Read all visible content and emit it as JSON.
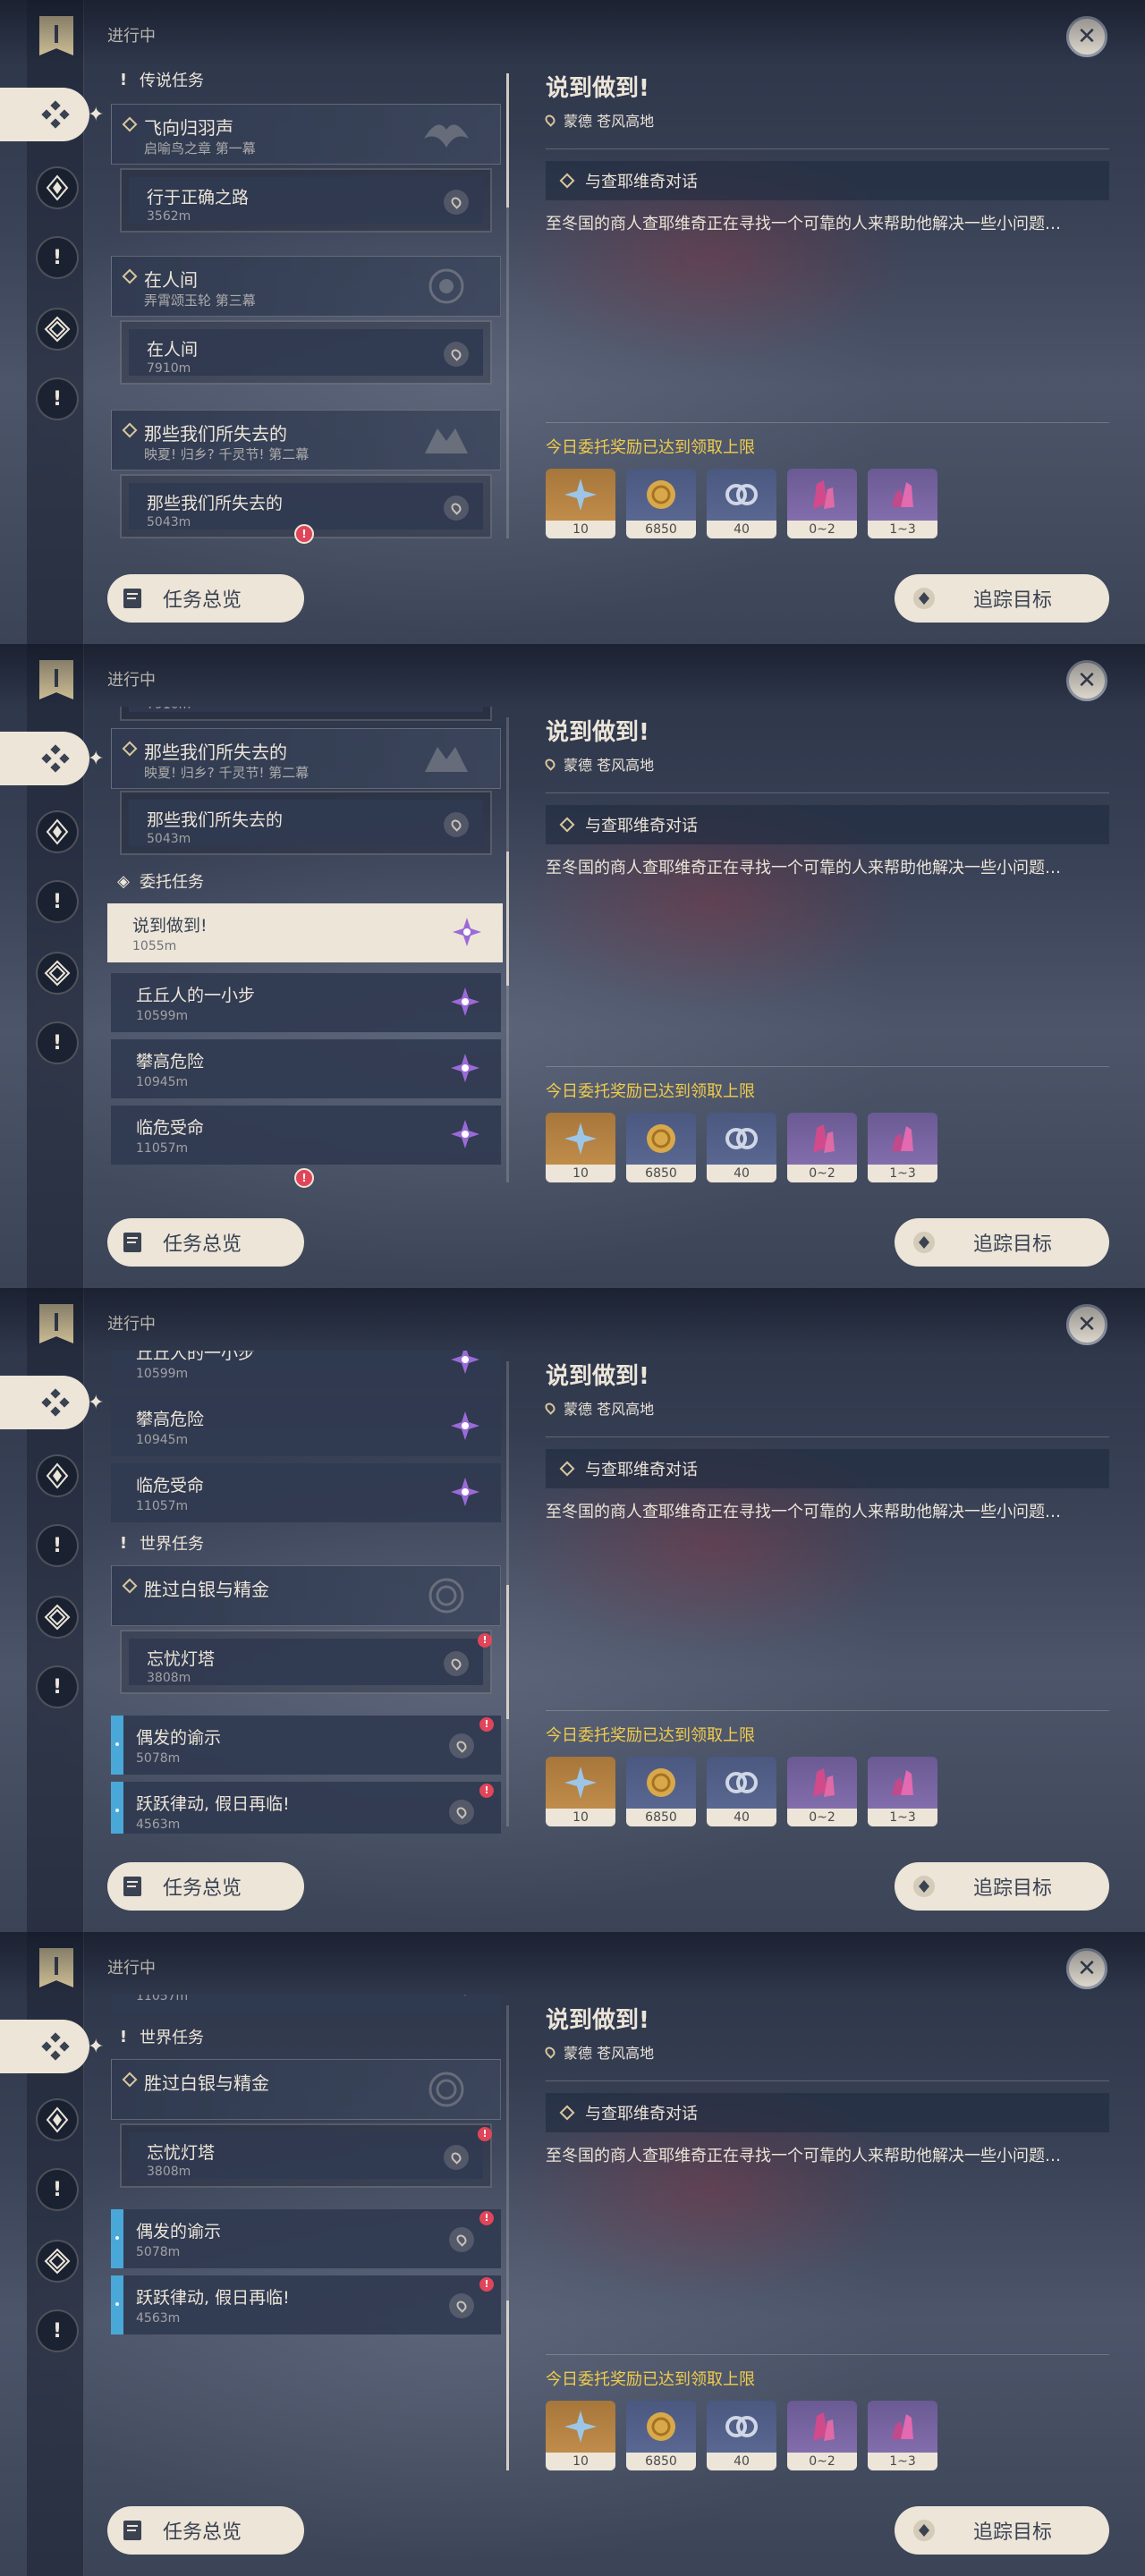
{
  "header": {
    "in_progress": "进行中"
  },
  "detail": {
    "title": "说到做到!",
    "location": "蒙德 苍风高地",
    "objective": "与查耶维奇对话",
    "description": "至冬国的商人查耶维奇正在寻找一个可靠的人来帮助他解决一些小问题…",
    "reward_limit": "今日委托奖励已达到领取上限",
    "rewards": [
      {
        "icon": "adventure-exp-icon",
        "count": "10"
      },
      {
        "icon": "mora-coin-icon",
        "count": "6850"
      },
      {
        "icon": "friendship-exp-icon",
        "count": "40"
      },
      {
        "icon": "pink-crystal-icon",
        "count": "0~2"
      },
      {
        "icon": "crystal-chunk-icon",
        "count": "1~3"
      }
    ]
  },
  "buttons": {
    "overview": "任务总览",
    "track": "追踪目标"
  },
  "sections": {
    "legend": "传说任务",
    "commission": "委托任务",
    "world": "世界任务"
  },
  "quests": {
    "feixiang": {
      "title": "飞向归羽声",
      "subtitle": "启喻鸟之章 第一幕",
      "step": "行于正确之路",
      "dist": "3562m"
    },
    "renjian": {
      "title": "在人间",
      "subtitle": "弄霄颂玉轮 第三幕",
      "step": "在人间",
      "dist": "7910m",
      "partial_dist": "7910m"
    },
    "shiqu": {
      "title": "那些我们所失去的",
      "subtitle": "映夏! 归乡? 千灵节! 第二幕",
      "step": "那些我们所失去的",
      "dist": "5043m"
    },
    "shuodao": {
      "title": "说到做到!",
      "dist": "1055m"
    },
    "qiuqiu": {
      "title": "丘丘人的一小步",
      "dist": "10599m"
    },
    "pandeng": {
      "title": "攀高危险",
      "dist": "10945m"
    },
    "linwei": {
      "title": "临危受命",
      "dist": "11057m"
    },
    "baiyin": {
      "title": "胜过白银与精金",
      "step": "忘忧灯塔",
      "dist": "3808m"
    },
    "oufa": {
      "title": "偶发的谕示",
      "dist": "5078m"
    },
    "yueyue": {
      "title": "跃跃律动, 假日再临!",
      "dist": "4563m"
    }
  }
}
